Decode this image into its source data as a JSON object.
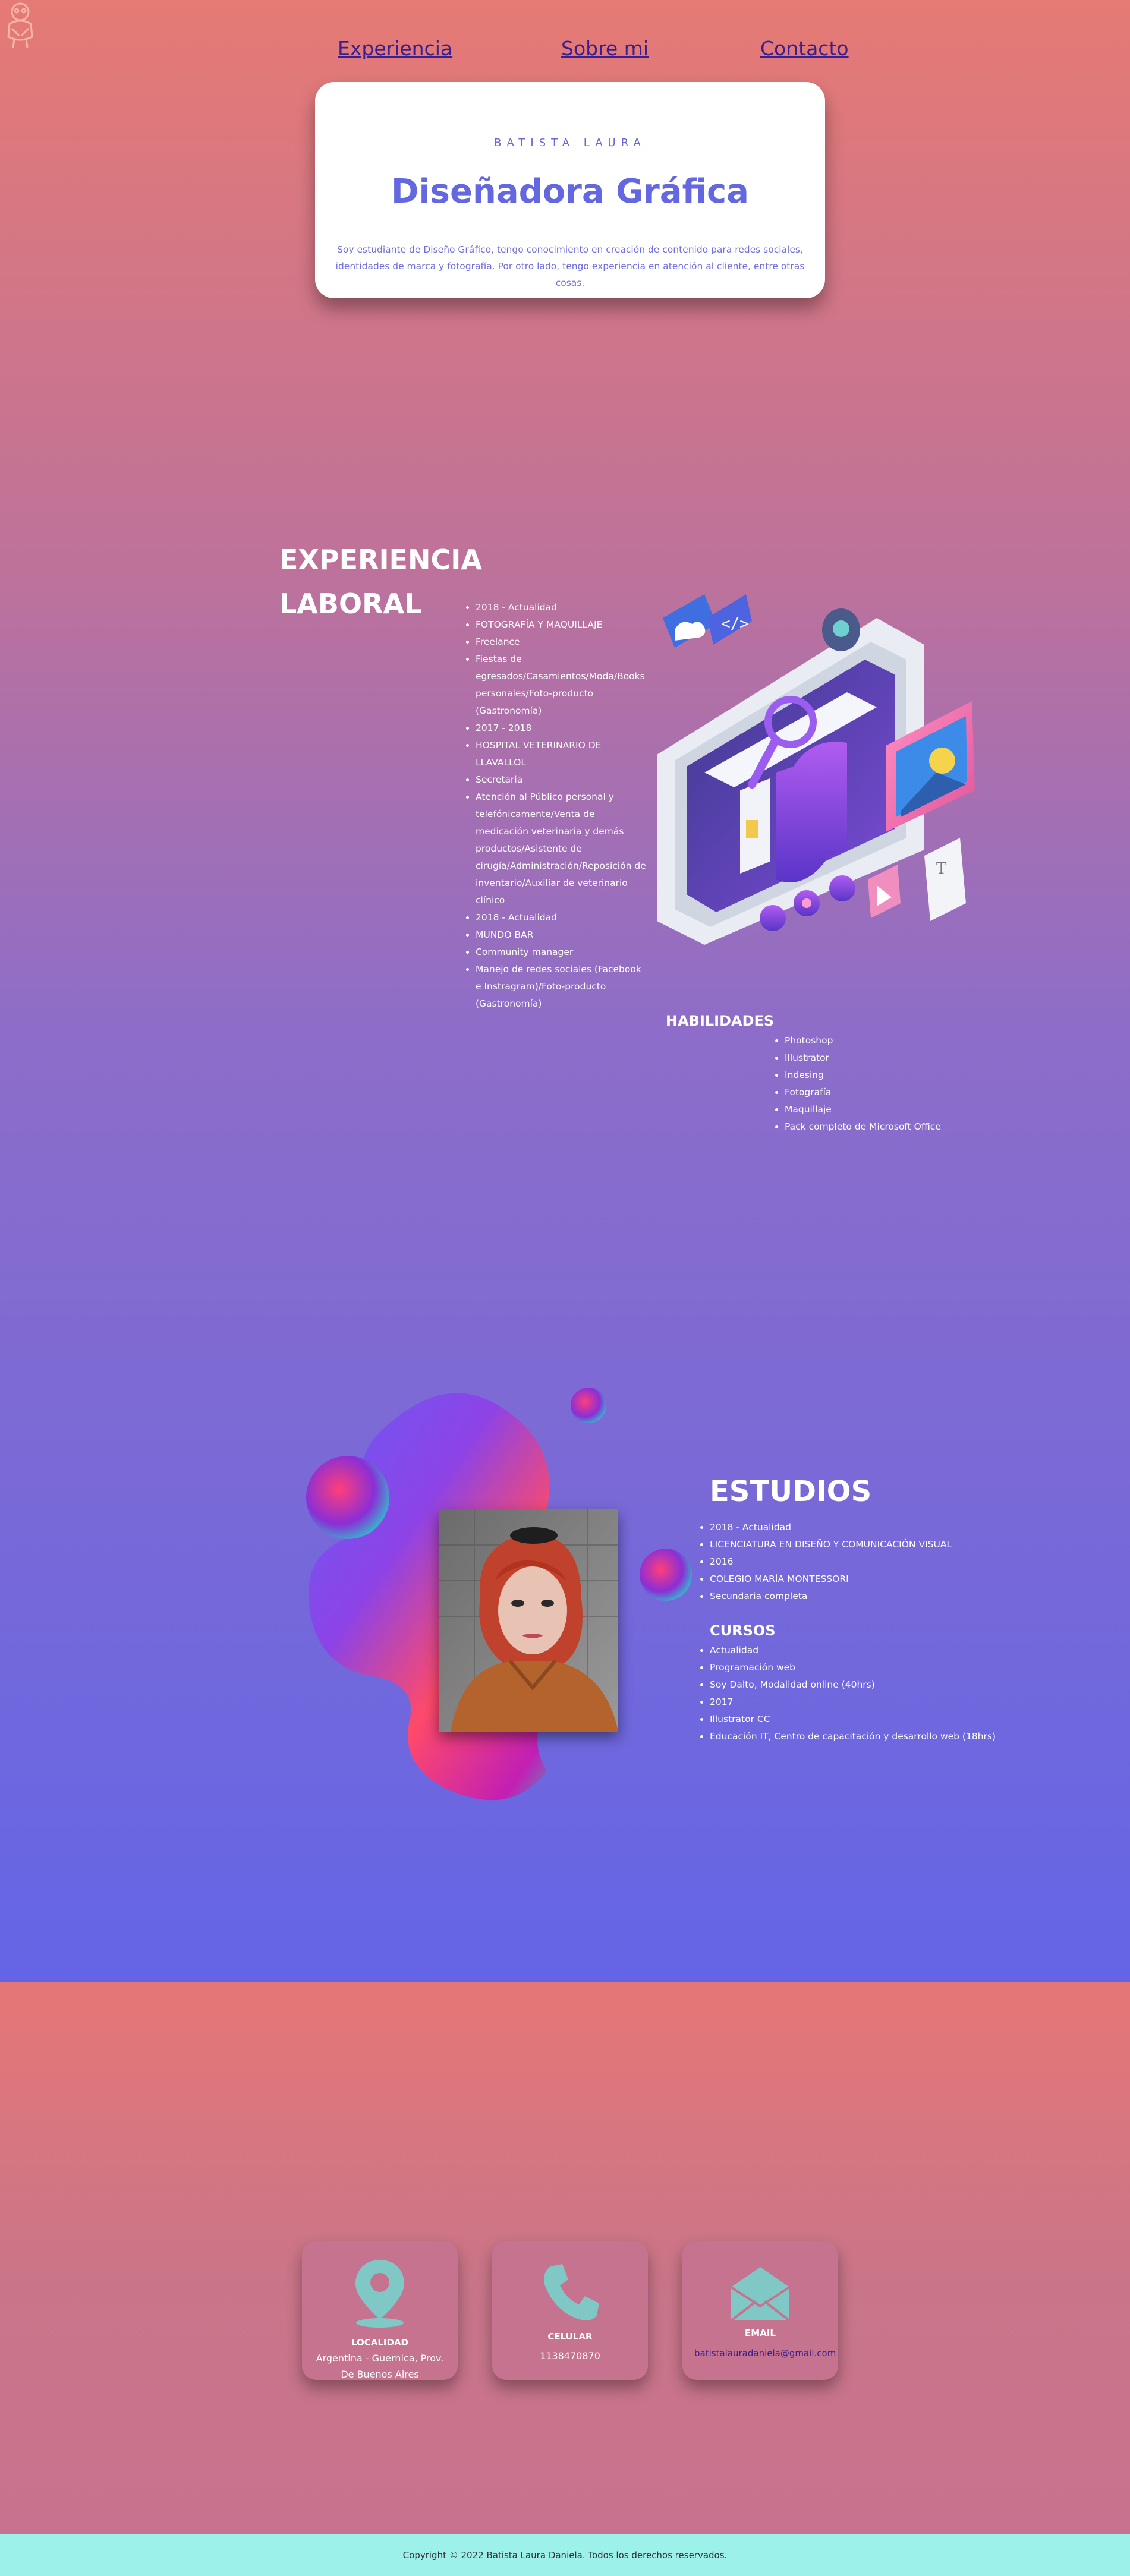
{
  "nav": {
    "experiencia": "Experiencia",
    "sobre_mi": "Sobre mi",
    "contacto": "Contacto"
  },
  "intro": {
    "name": "BATISTA LAURA",
    "title": "Diseñadora Gráfica",
    "text": "Soy estudiante de Diseño Gráfico, tengo conocimiento en creación de contenido para redes sociales, identidades de marca y fotografía. Por otro lado, tengo experiencia en atención al cliente, entre otras cosas."
  },
  "experience": {
    "title": "EXPERIENCIA LABORAL",
    "items": [
      "2018 - Actualidad",
      "FOTOGRAFÍA Y MAQUILLAJE",
      "Freelance",
      "Fiestas de egresados/Casamientos/Moda/Books personales/Foto-producto (Gastronomía)",
      "2017 - 2018",
      "HOSPITAL VETERINARIO DE LLAVALLOL",
      "Secretaria",
      "Atención al Público personal y telefónicamente/Venta de medicación veterinaria y demás productos/Asistente de cirugía/Administración/Reposición de inventario/Auxiliar de veterinario clínico",
      "2018 - Actualidad",
      "MUNDO BAR",
      "Community manager",
      "Manejo de redes sociales (Facebook e Instragram)/Foto-producto (Gastronomía)"
    ]
  },
  "skills": {
    "title": "HABILIDADES",
    "items": [
      "Photoshop",
      "Illustrator",
      "Indesing",
      "Fotografía",
      "Maquillaje",
      "Pack completo de Microsoft Office"
    ]
  },
  "studies": {
    "title": "ESTUDIOS",
    "items": [
      "2018 - Actualidad",
      "LICENCIATURA EN DISEÑO Y COMUNICACIÓN VISUAL",
      "2016",
      "COLEGIO MARÍA MONTESSORI",
      "Secundaria completa"
    ]
  },
  "courses": {
    "title": "CURSOS",
    "items": [
      "Actualidad",
      "Programación web",
      "Soy Dalto, Modalidad online (40hrs)",
      "2017",
      "Illustrator CC",
      "Educación IT, Centro de capacitación y desarrollo web (18hrs)"
    ]
  },
  "contact": {
    "location": {
      "title": "LOCALIDAD",
      "value": "Argentina - Guernica, Prov. De Buenos Aires",
      "icon": "location-pin-icon"
    },
    "phone": {
      "title": "CELULAR",
      "value": "1138470870",
      "icon": "phone-icon"
    },
    "email": {
      "title": "EMAIL",
      "value": "batistalauradaniela@gmail.com",
      "icon": "envelope-icon"
    }
  },
  "footer": {
    "copyright": "Copyright © 2022 Batista Laura Daniela. Todos los derechos reservados."
  },
  "colors": {
    "accent": "#6367e0",
    "nav_link": "#3b1f8f",
    "icon_teal": "#7fc8c6",
    "footer_bg": "#9cf1ea"
  }
}
